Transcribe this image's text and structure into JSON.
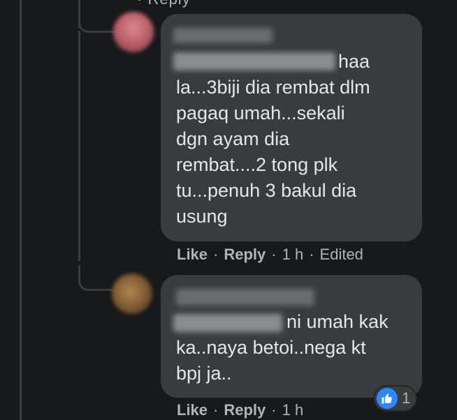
{
  "top_partial": "Reply",
  "comments": [
    {
      "text_lines": [
        "haa",
        "la...3biji dia rembat dlm",
        "pagaq umah...sekali",
        "dgn ayam dia",
        "rembat....2 tong plk",
        "tu...penuh 3 bakul dia",
        "usung"
      ],
      "actions": {
        "like": "Like",
        "reply": "Reply",
        "time": "1 h",
        "edited": "Edited"
      },
      "avatar_color": "#c46a72"
    },
    {
      "text_lines": [
        "ni umah kak",
        "ka..naya betoi..nega kt",
        "bpj ja.."
      ],
      "actions": {
        "like": "Like",
        "reply": "Reply",
        "time": "1 h"
      },
      "reaction": {
        "icon": "thumbs-up-icon",
        "count": "1"
      },
      "avatar_color": "#8a6a3c"
    }
  ],
  "dot": "·",
  "colors": {
    "background": "#18191a",
    "bubble": "#3a3b3c",
    "text": "#e4e6eb",
    "meta": "#b0b3b8",
    "like_blue": "#2d88ff"
  }
}
